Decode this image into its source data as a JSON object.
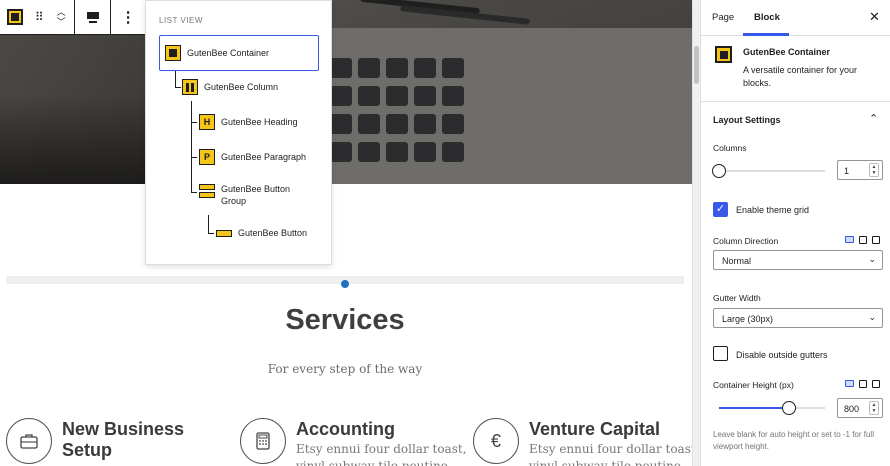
{
  "toolbar": {
    "block_icon": "container-block-icon",
    "drag_icon": "drag-handle-icon",
    "move_up_icon": "chevron-up-icon",
    "move_down_icon": "chevron-down-icon",
    "align_icon": "align-top-icon",
    "more_icon": "more-vertical-icon",
    "drag_glyph": "⠿",
    "more_glyph": "⋮",
    "up_glyph": "︿",
    "down_glyph": "﹀"
  },
  "list_view": {
    "title": "LIST VIEW",
    "items": [
      {
        "label": "GutenBee Container",
        "icon": "container-block-icon",
        "selected": true
      },
      {
        "label": "GutenBee Column",
        "icon": "column-block-icon"
      },
      {
        "label": "GutenBee Heading",
        "icon": "heading-block-icon",
        "glyph": "H"
      },
      {
        "label": "GutenBee Paragraph",
        "icon": "paragraph-block-icon",
        "glyph": "P"
      },
      {
        "label": "GutenBee Button Group",
        "icon": "button-group-block-icon"
      },
      {
        "label": "GutenBee Button",
        "icon": "button-block-icon"
      }
    ]
  },
  "content": {
    "services_title": "Services",
    "services_subtitle": "For every step of the way",
    "services": [
      {
        "name_line1": "New Business",
        "name_line2": "Setup",
        "desc": "",
        "icon": "briefcase-icon",
        "glyph": "💼"
      },
      {
        "name_line1": "Accounting",
        "name_line2": "",
        "desc": "Etsy ennui four dollar toast,",
        "desc2": "vinyl subway tile poutine",
        "icon": "calculator-icon",
        "glyph": "🖩"
      },
      {
        "name_line1": "Venture Capital",
        "name_line2": "",
        "desc": "Etsy ennui four dollar toast,",
        "desc2": "vinyl subway tile poutine",
        "icon": "euro-icon",
        "glyph": "€"
      }
    ]
  },
  "sidebar": {
    "tab_page": "Page",
    "tab_block": "Block",
    "close_glyph": "✕",
    "block_card": {
      "title": "GutenBee Container",
      "description": "A versatile container for your blocks."
    },
    "panel": {
      "title": "Layout Settings",
      "chevron": "⌃",
      "columns_label": "Columns",
      "columns_value": "1",
      "columns_fraction": 0.0,
      "enable_grid_label": "Enable theme grid",
      "enable_grid_checked": true,
      "column_direction_label": "Column Direction",
      "column_direction_value": "Normal",
      "gutter_width_label": "Gutter Width",
      "gutter_width_value": "Large (30px)",
      "disable_gutters_label": "Disable outside gutters",
      "disable_gutters_checked": false,
      "container_height_label": "Container Height (px)",
      "container_height_value": "800",
      "container_height_fraction": 0.66,
      "help_text": "Leave blank for auto height or set to -1 for full viewport height."
    },
    "device_icons": [
      "desktop-icon",
      "tablet-icon",
      "mobile-icon"
    ]
  },
  "colors": {
    "accent": "#3858e9",
    "block_yellow": "#f5c518",
    "separator_dot": "#1e73be"
  }
}
